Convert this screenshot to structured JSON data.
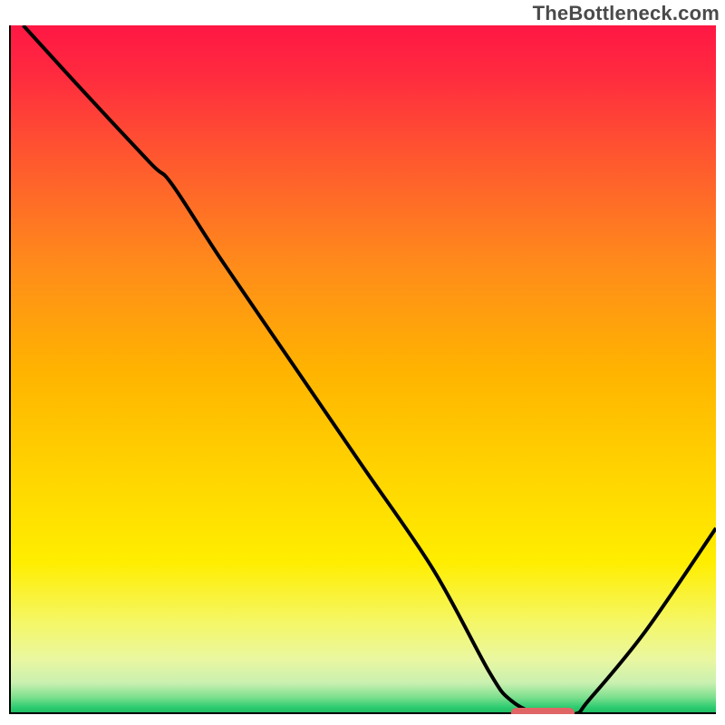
{
  "watermark": "TheBottleneck.com",
  "chart_data": {
    "type": "line",
    "title": "",
    "xlabel": "",
    "ylabel": "",
    "xlim": [
      0,
      100
    ],
    "ylim": [
      0,
      100
    ],
    "x": [
      2,
      10,
      20,
      23,
      30,
      40,
      50,
      60,
      68,
      71,
      75,
      80,
      82,
      90,
      100
    ],
    "y": [
      100,
      91,
      80,
      77,
      66,
      51,
      36,
      21,
      6,
      2,
      0,
      0,
      2,
      12,
      27
    ],
    "marker": {
      "x_start": 71,
      "x_end": 80,
      "y": 0,
      "color": "#e06666"
    },
    "gradient_stops": [
      {
        "offset": 0.0,
        "color": "#ff1744"
      },
      {
        "offset": 0.07,
        "color": "#ff2a3f"
      },
      {
        "offset": 0.2,
        "color": "#ff5a2e"
      },
      {
        "offset": 0.35,
        "color": "#ff8c1a"
      },
      {
        "offset": 0.5,
        "color": "#ffb300"
      },
      {
        "offset": 0.65,
        "color": "#ffd400"
      },
      {
        "offset": 0.78,
        "color": "#ffee00"
      },
      {
        "offset": 0.87,
        "color": "#f4f76a"
      },
      {
        "offset": 0.92,
        "color": "#eaf7a0"
      },
      {
        "offset": 0.955,
        "color": "#c9f0b0"
      },
      {
        "offset": 0.975,
        "color": "#7fe08f"
      },
      {
        "offset": 0.99,
        "color": "#2ecc71"
      },
      {
        "offset": 1.0,
        "color": "#17b85e"
      }
    ]
  }
}
